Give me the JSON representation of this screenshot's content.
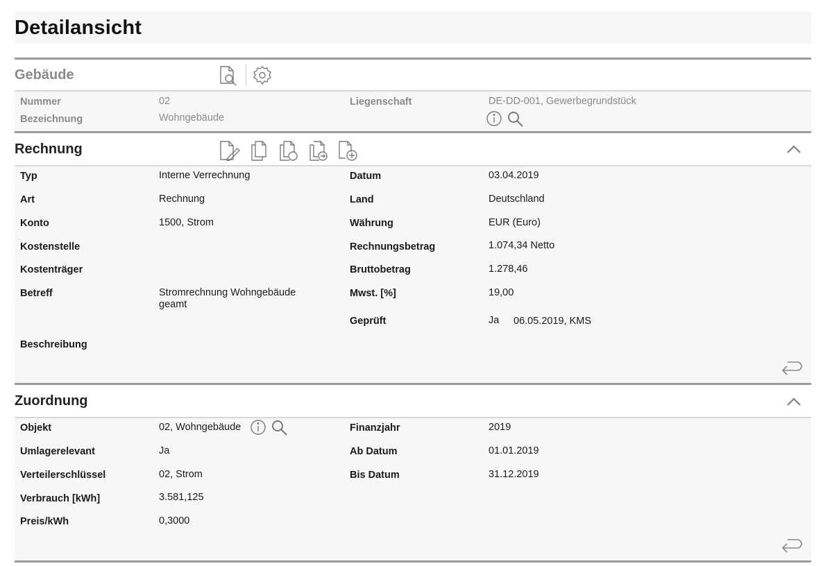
{
  "page": {
    "title": "Detailansicht"
  },
  "gebaeude": {
    "title": "Gebäude",
    "fields": {
      "nummer": {
        "label": "Nummer",
        "value": "02"
      },
      "bezeichnung": {
        "label": "Bezeichnung",
        "value": "Wohngebäude"
      },
      "liegenschaft": {
        "label": "Liegenschaft",
        "value": "DE-DD-001, Gewerbegrundstück"
      }
    },
    "icons": [
      "document-search-icon",
      "gear-icon",
      "info-icon",
      "search-icon"
    ]
  },
  "rechnung": {
    "title": "Rechnung",
    "icons": [
      "edit-document-icon",
      "copy-document-icon",
      "document-circle-icon",
      "document-forward-icon",
      "document-add-icon",
      "collapse-chevron-icon",
      "return-arrow-icon"
    ],
    "left": {
      "typ": {
        "label": "Typ",
        "value": "Interne Verrechnung"
      },
      "art": {
        "label": "Art",
        "value": "Rechnung"
      },
      "konto": {
        "label": "Konto",
        "value": "1500, Strom"
      },
      "kostenstelle": {
        "label": "Kostenstelle",
        "value": ""
      },
      "kostentraeger": {
        "label": "Kostenträger",
        "value": ""
      },
      "betreff": {
        "label": "Betreff",
        "value_line1": "Stromrechnung Wohngebäude",
        "value_line2": "geamt"
      },
      "beschreibung": {
        "label": "Beschreibung",
        "value": ""
      }
    },
    "right": {
      "datum": {
        "label": "Datum",
        "value": "03.04.2019"
      },
      "land": {
        "label": "Land",
        "value": "Deutschland"
      },
      "waehrung": {
        "label": "Währung",
        "value": "EUR (Euro)"
      },
      "rechnungsbetrag": {
        "label": "Rechnungsbetrag",
        "value": "1.074,34 Netto"
      },
      "bruttobetrag": {
        "label": "Bruttobetrag",
        "value": "1.278,46"
      },
      "mwst": {
        "label": "Mwst. [%]",
        "value": "19,00"
      },
      "geprueft": {
        "label": "Geprüft",
        "value": "Ja",
        "detail": "06.05.2019, KMS"
      }
    }
  },
  "zuordnung": {
    "title": "Zuordnung",
    "icons": [
      "info-icon",
      "search-icon",
      "collapse-chevron-icon",
      "return-arrow-icon"
    ],
    "left": {
      "objekt": {
        "label": "Objekt",
        "value": "02, Wohngebäude"
      },
      "umlagerelevant": {
        "label": "Umlagerelevant",
        "value": "Ja"
      },
      "verteilerschluessel": {
        "label": "Verteilerschlüssel",
        "value": "02, Strom"
      },
      "verbrauch": {
        "label": "Verbrauch [kWh]",
        "value": "3.581,125"
      },
      "preis": {
        "label": "Preis/kWh",
        "value": "0,3000"
      }
    },
    "right": {
      "finanzjahr": {
        "label": "Finanzjahr",
        "value": "2019"
      },
      "ab_datum": {
        "label": "Ab Datum",
        "value": "01.01.2019"
      },
      "bis_datum": {
        "label": "Bis Datum",
        "value": "31.12.2019"
      }
    }
  }
}
